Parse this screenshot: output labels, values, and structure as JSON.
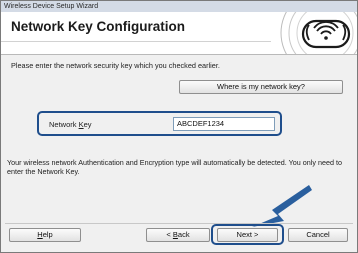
{
  "window": {
    "title": "Wireless Device Setup Wizard"
  },
  "header": {
    "title": "Network Key Configuration",
    "logo_icon": "wireless-signal-icon"
  },
  "intro_text": "Please enter the network security key which you checked earlier.",
  "help_link_button": {
    "label": "Where is my network key?"
  },
  "network_key": {
    "label_prefix": "Network ",
    "label_mnemonic": "K",
    "label_suffix": "ey",
    "value": "ABCDEF1234"
  },
  "info_text": "Your wireless network Authentication and Encryption type will automatically be detected. You only need to enter the Network Key.",
  "footer": {
    "help_label_mnemonic": "H",
    "help_label_rest": "elp",
    "back_label_prefix": "< ",
    "back_label_mnemonic": "B",
    "back_label_rest": "ack",
    "next_label": "Next >",
    "cancel_label": "Cancel"
  },
  "colors": {
    "highlight": "#1f4e8c",
    "arrow": "#2a5f9e"
  }
}
